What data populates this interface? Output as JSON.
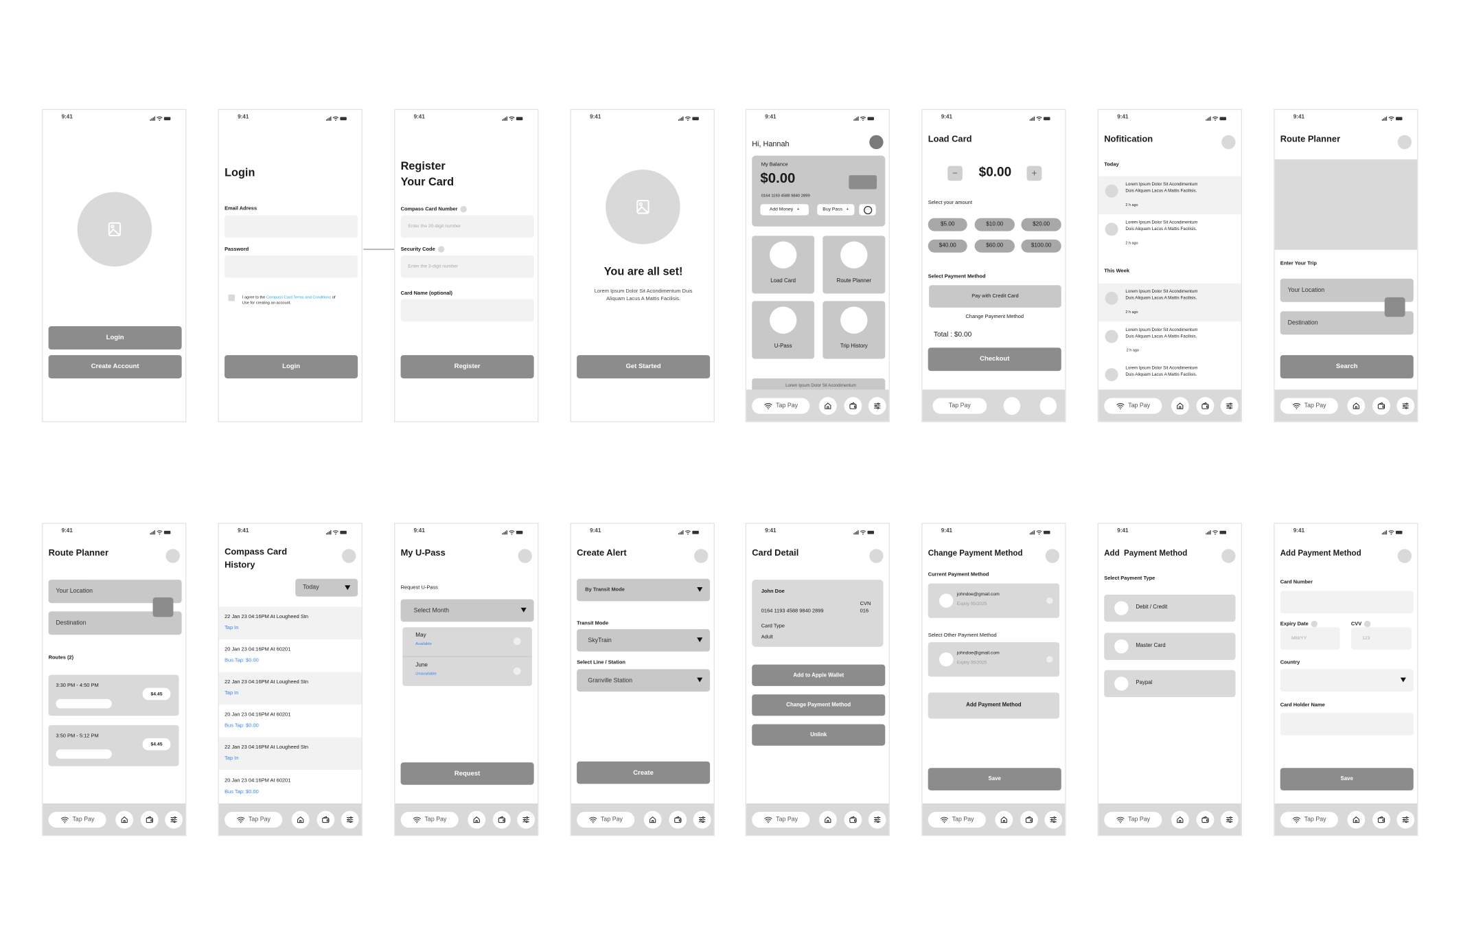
{
  "status": {
    "time": "9:41"
  },
  "nav": {
    "tap_pay": "Tap Pay"
  },
  "colors": {
    "primary_button": "#8c8c8c",
    "field": "#c8c8c8",
    "input": "#f2f2f2",
    "link": "#3b82f6"
  },
  "welcome": {
    "login": "Login",
    "create_account": "Create Account"
  },
  "login": {
    "title": "Login",
    "email_label": "Email Adress",
    "password_label": "Password",
    "agree_prefix": "I agree to the ",
    "agree_link": "Compass Card Terms and Conditions",
    "agree_suffix": " of Use for creating an account.",
    "login_button": "Login"
  },
  "register": {
    "title_line1": "Register",
    "title_line2": "Your Card",
    "card_number_label": "Compass Card Number",
    "card_number_placeholder": "Enter the 20-digit number",
    "security_label": "Security Code",
    "security_placeholder": "Enter the 3-digit number",
    "card_name_label": "Card Name (optional)",
    "register_button": "Register"
  },
  "all_set": {
    "title": "You are all set!",
    "body": "Lorem Ipsum Dolor Sit Acondimentum Duis Aliquam Lacus A Mattis Facilisis.",
    "button": "Get Started"
  },
  "home": {
    "greeting": "Hi, Hannah",
    "balance_label": "My Balance",
    "balance": "$0.00",
    "card_number": "0164 1193 4588 9840 2899",
    "add_money": "Add Money",
    "buy_pass": "Buy Pass",
    "tiles": [
      "Load Card",
      "Route Planner",
      "U-Pass",
      "Trip History"
    ],
    "peek_text": "Lorem Ipsum Dolor Sit Acondimentum"
  },
  "load_card": {
    "title": "Load Card",
    "amount": "$0.00",
    "select_amount": "Select your amount",
    "amounts": [
      "$5.00",
      "$10.00",
      "$20.00",
      "$40.00",
      "$60.00",
      "$100.00"
    ],
    "payment_label": "Select Payment Method",
    "pay_credit": "Pay with Credit Card",
    "change_method": "Change Payment Method",
    "total": "Total : $0.00",
    "checkout": "Checkout"
  },
  "notifications": {
    "title": "Nofitication",
    "today": "Today",
    "this_week": "This Week",
    "item_line1": "Lorem Ipsum Dolor Sit Acondimentum",
    "item_line2": "Duis Aliquam Lacus A Mattis Facilisis.",
    "time_ago": "2 h ago"
  },
  "route_planner": {
    "title": "Route Planner",
    "enter_trip": "Enter Your Trip",
    "location": "Your Location",
    "destination": "Destination",
    "search": "Search",
    "routes_label": "Routes (2)",
    "routes": [
      {
        "time": "3:30 PM - 4:50 PM",
        "price": "$4.45"
      },
      {
        "time": "3:50 PM - 5:12 PM",
        "price": "$4.45"
      }
    ]
  },
  "history": {
    "title_line1": "Compass Card",
    "title_line2": "History",
    "filter": "Today",
    "rows": [
      {
        "text": "22 Jan 23 04:16PM At Lougheed Stn",
        "sub": "Tap In"
      },
      {
        "text": "20 Jan 23 04:16PM At 60201",
        "sub": "Bus Tap: $0.00"
      },
      {
        "text": "22 Jan 23 04:16PM At Lougheed Stn",
        "sub": "Tap In"
      },
      {
        "text": "20 Jan 23 04:16PM At 60201",
        "sub": "Bus Tap: $0.00"
      },
      {
        "text": "22 Jan 23 04:16PM At Lougheed Stn",
        "sub": "Tap In"
      },
      {
        "text": "20 Jan 23 04:16PM At 60201",
        "sub": "Bus Tap: $0.00"
      }
    ]
  },
  "upass": {
    "title": "My U-Pass",
    "request_label": "Request U-Pass",
    "select_month": "Select Month",
    "months": [
      {
        "name": "May",
        "status": "Available"
      },
      {
        "name": "June",
        "status": "Unavailable"
      }
    ],
    "request_button": "Request"
  },
  "alert": {
    "title": "Create Alert",
    "by_mode": "By Transit Mode",
    "mode_label": "Transit Mode",
    "mode_value": "SkyTrain",
    "line_label": "Select Line / Station",
    "line_value": "Granville Station",
    "create": "Create"
  },
  "card_detail": {
    "title": "Card Detail",
    "name": "John Doe",
    "cvn_label": "CVN",
    "number": "0164 1193 4588 9840 2899",
    "cvn": "016",
    "type_label": "Card Type",
    "type": "Adult",
    "apple_wallet": "Add to Apple Wallet",
    "change_method": "Change Payment Method",
    "unlink": "Unlink"
  },
  "change_payment": {
    "title": "Change Payment Method",
    "current_label": "Current Payment Method",
    "other_label": "Select Other Payment Method",
    "email": "johndoe@gmail.com",
    "expiry": "Expiry 05/2025",
    "add_method": "Add Payment Method",
    "save": "Save"
  },
  "add_payment": {
    "title": "Add  Payment Method",
    "type_label": "Select Payment Type",
    "types": [
      "Debit / Credit",
      "Master Card",
      "Paypal"
    ]
  },
  "add_card": {
    "title": "Add Payment Method",
    "card_number": "Card Number",
    "expiry": "Expiry Date",
    "expiry_placeholder": "MM/YY",
    "cvv": "CVV",
    "cvv_placeholder": "123",
    "country": "Country",
    "holder": "Card Holder Name",
    "save": "Save"
  }
}
